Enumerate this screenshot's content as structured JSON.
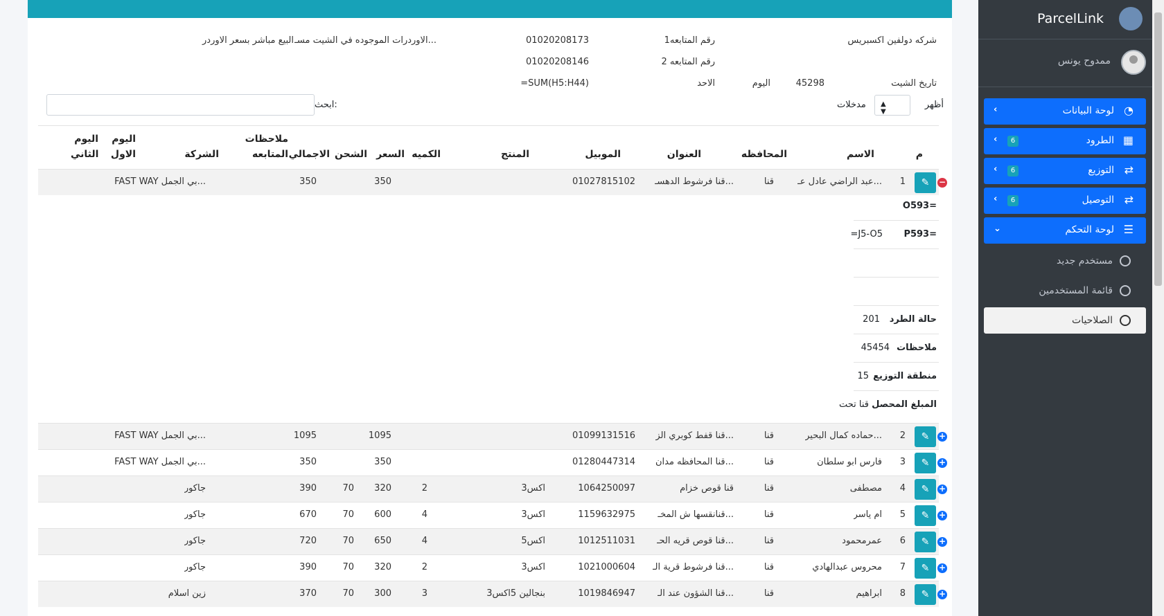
{
  "header": {
    "company": "شركه دولفين اكسبريس",
    "tracking1_label": "رقم المتابعه1",
    "tracking1_value": "01020208173",
    "tracking2_label": "رقم المتابعه 2",
    "tracking2_value": "01020208146",
    "orders_note": "الاوردرات الموجوده في الشيت مسـ...",
    "direct_sale": "البيع مباشر بسعر الاوردر",
    "sheet_date_label": "تاريخ الشيت",
    "sheet_date_value": "45298",
    "day_label": "اليوم",
    "day_value": "الاحد",
    "formula": "=SUM(H5:H44)"
  },
  "controls": {
    "show_label": "أظهر",
    "entries_label": "مدخلات",
    "search_label": "ابحث:",
    "entries_icon": "sort-arrows-icon"
  },
  "columns": {
    "num": "م",
    "name": "الاسم",
    "gov": "المحافظه",
    "address": "العنوان",
    "mobile": "الموبيل",
    "product": "المنتج",
    "qty": "الكميه",
    "price": "السعر",
    "shipping": "الشحن",
    "total": "الاجمالي",
    "notes": "ملاحظات المتابعه",
    "company": "الشركة",
    "day1": "اليوم الاول",
    "day2": "اليوم الثاني"
  },
  "rows": [
    {
      "num": "1",
      "name": "عبد الراضي عادل عـ...",
      "gov": "قنا",
      "address": "قنا فرشوط الدهسـ...",
      "mobile": "01027815102",
      "product": "",
      "qty": "",
      "price": "350",
      "shipping": "",
      "total": "350",
      "company": "FAST WAY بي الجمل..."
    },
    {
      "num": "2",
      "name": "حماده كمال البحير...",
      "gov": "قنا",
      "address": "قنا قفط كوبري الز...",
      "mobile": "01099131516",
      "product": "",
      "qty": "",
      "price": "1095",
      "shipping": "",
      "total": "1095",
      "company": "FAST WAY بي الجمل..."
    },
    {
      "num": "3",
      "name": "فارس ابو سلطان",
      "gov": "قنا",
      "address": "قنا المحافظه مدان...",
      "mobile": "01280447314",
      "product": "",
      "qty": "",
      "price": "350",
      "shipping": "",
      "total": "350",
      "company": "FAST WAY بي الجمل..."
    },
    {
      "num": "4",
      "name": "مصطفى",
      "gov": "قنا",
      "address": "قنا قوص خزام",
      "mobile": "1064250097",
      "product": "3اكس",
      "qty": "2",
      "price": "320",
      "shipping": "70",
      "total": "390",
      "company": "جاكور"
    },
    {
      "num": "5",
      "name": "ام ياسر",
      "gov": "قنا",
      "address": "قنانقسها ش المخـ...",
      "mobile": "1159632975",
      "product": "3اكس",
      "qty": "4",
      "price": "600",
      "shipping": "70",
      "total": "670",
      "company": "جاكور"
    },
    {
      "num": "6",
      "name": "عمرمحمود",
      "gov": "قنا",
      "address": "قنا قوص قريه الحـ...",
      "mobile": "1012511031",
      "product": "5اكس",
      "qty": "4",
      "price": "650",
      "shipping": "70",
      "total": "720",
      "company": "جاكور"
    },
    {
      "num": "7",
      "name": "محروس عبدالهادي",
      "gov": "قنا",
      "address": "قنا فرشوط قرية الـ...",
      "mobile": "1021000604",
      "product": "3اكس",
      "qty": "2",
      "price": "320",
      "shipping": "70",
      "total": "390",
      "company": "جاكور"
    },
    {
      "num": "8",
      "name": "ابراهيم",
      "gov": "قنا",
      "address": "قنا الشؤون عند الـ...",
      "mobile": "1019846947",
      "product": "3بنجالين 5اكس",
      "qty": "3",
      "price": "300",
      "shipping": "70",
      "total": "370",
      "company": "زين اسلام"
    }
  ],
  "expanded": {
    "o_label": "O593=",
    "p_label": "P593=",
    "p_value": "=J5-O5",
    "status_label": "حالة الطرد",
    "status_value": "201",
    "notes_label": "ملاحظات",
    "notes_value": "45454",
    "zone_label": "منطقة التوزيع",
    "zone_value": "15",
    "amount_label": "المبلغ المحصل",
    "amount_value": "قنا تحت"
  },
  "sidebar": {
    "brand": "ParcelLink",
    "user_name": "ممدوح يونس",
    "nav": [
      {
        "label": "لوحة البيانات",
        "icon": "dashboard-gauge-icon",
        "badge": ""
      },
      {
        "label": "الطرود",
        "icon": "boxes-icon",
        "badge": "6"
      },
      {
        "label": "التوزيع",
        "icon": "retweet-icon",
        "badge": "6"
      },
      {
        "label": "التوصيل",
        "icon": "retweet-icon",
        "badge": "6"
      },
      {
        "label": "لوحة التحكم",
        "icon": "server-icon",
        "badge": ""
      }
    ],
    "sub": [
      {
        "label": "مستخدم جديد"
      },
      {
        "label": "قائمة المستخدمين"
      },
      {
        "label": "الصلاحيات"
      }
    ]
  },
  "colors": {
    "teal": "#17a2b8",
    "primary": "#0d6efd",
    "sidebar_bg": "#343a40",
    "danger": "#dc3545"
  }
}
